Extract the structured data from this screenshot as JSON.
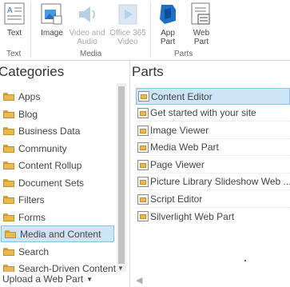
{
  "ribbon": {
    "buttons": [
      {
        "label1": "Text",
        "label2": "",
        "icon": "text-box-icon",
        "enabled": true
      },
      {
        "label1": "Image",
        "label2": "",
        "icon": "image-icon",
        "enabled": true
      },
      {
        "label1": "Video and",
        "label2": "Audio",
        "icon": "speaker-icon",
        "enabled": false
      },
      {
        "label1": "Office 365",
        "label2": "Video",
        "icon": "office-video-icon",
        "enabled": false
      },
      {
        "label1": "App",
        "label2": "Part",
        "icon": "app-part-icon",
        "enabled": true
      },
      {
        "label1": "Web",
        "label2": "Part",
        "icon": "web-part-icon",
        "enabled": true
      }
    ],
    "groups": [
      "Text",
      "Media",
      "Parts"
    ]
  },
  "categories": {
    "heading": "Categories",
    "items": [
      "Apps",
      "Blog",
      "Business Data",
      "Community",
      "Content Rollup",
      "Document Sets",
      "Filters",
      "Forms",
      "Media and Content",
      "Search",
      "Search-Driven Content"
    ],
    "selected_index": 8
  },
  "parts": {
    "heading": "Parts",
    "items": [
      "Content Editor",
      "Get started with your site",
      "Image Viewer",
      "Media Web Part",
      "Page Viewer",
      "Picture Library Slideshow Web ...",
      "Script Editor",
      "Silverlight Web Part"
    ],
    "selected_index": 0
  },
  "footer": {
    "upload_label": "Upload a Web Part"
  },
  "colors": {
    "selection_bg": "#cde6f7",
    "selection_border": "#92c0e0",
    "brand_blue": "#2b7cd3"
  }
}
